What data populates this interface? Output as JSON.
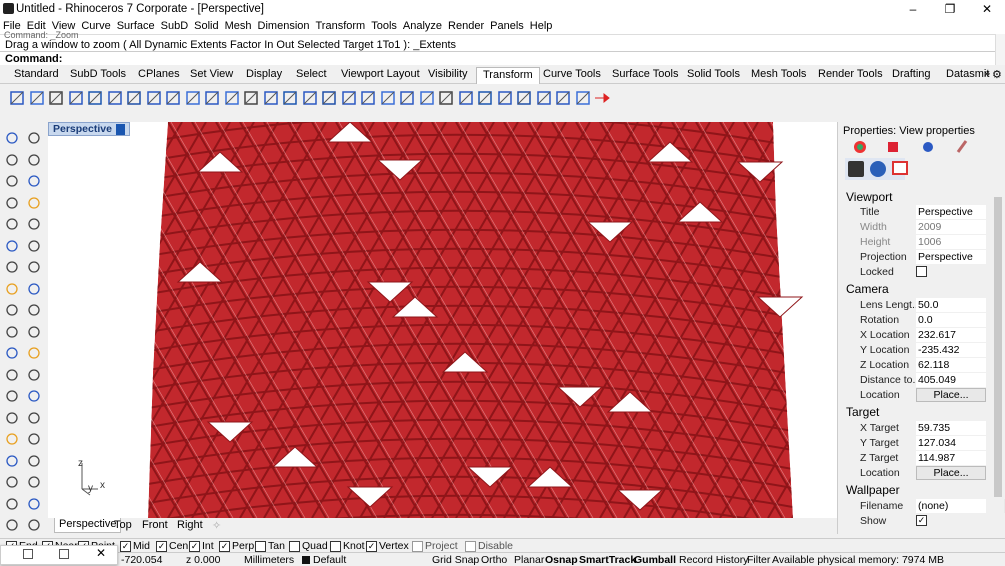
{
  "titlebar": {
    "title": "Untitled - Rhinoceros 7 Corporate - [Perspective]",
    "minimize": "–",
    "maximize": "❐",
    "close": "✕"
  },
  "menu": [
    "File",
    "Edit",
    "View",
    "Curve",
    "Surface",
    "SubD",
    "Solid",
    "Mesh",
    "Dimension",
    "Transform",
    "Tools",
    "Analyze",
    "Render",
    "Panels",
    "Help"
  ],
  "command": {
    "history_prev": "Command: _Zoom",
    "history_current": "Drag a window to zoom ( All  Dynamic  Extents  Factor  In  Out  Selected  Target  1To1 ): _Extents",
    "prompt": "Command:"
  },
  "toolbar_tabs": [
    "Standard",
    "SubD Tools",
    "CPlanes",
    "Set View",
    "Display",
    "Select",
    "Viewport Layout",
    "Visibility",
    "Transform",
    "Curve Tools",
    "Surface Tools",
    "Solid Tools",
    "Mesh Tools",
    "Render Tools",
    "Drafting",
    "Datasmit"
  ],
  "toolbar_tabs_active": "Transform",
  "toolbar_more": "»",
  "toolbar_settings": "⚙",
  "viewport": {
    "label": "Perspective",
    "axis_z": "z",
    "axis_y": "y",
    "axis_x": "x"
  },
  "viewport_tabs": [
    "Perspective",
    "Top",
    "Front",
    "Right"
  ],
  "viewport_tabs_add": "✧",
  "properties": {
    "title": "Properties: View properties",
    "viewport_section": "Viewport",
    "title_label": "Title",
    "title_value": "Perspective",
    "width_label": "Width",
    "width_value": "2009",
    "height_label": "Height",
    "height_value": "1006",
    "projection_label": "Projection",
    "projection_value": "Perspective",
    "locked_label": "Locked",
    "camera_section": "Camera",
    "lens_label": "Lens Lengt...",
    "lens_value": "50.0",
    "rotation_label": "Rotation",
    "rotation_value": "0.0",
    "xloc_label": "X Location",
    "xloc_value": "232.617",
    "yloc_label": "Y Location",
    "yloc_value": "-235.432",
    "zloc_label": "Z Location",
    "zloc_value": "62.118",
    "dist_label": "Distance to...",
    "dist_value": "405.049",
    "location_label": "Location",
    "place_button": "Place...",
    "target_section": "Target",
    "xt_label": "X Target",
    "xt_value": "59.735",
    "yt_label": "Y Target",
    "yt_value": "127.034",
    "zt_label": "Z Target",
    "zt_value": "114.987",
    "tloc_label": "Location",
    "tplace_button": "Place...",
    "wallpaper_section": "Wallpaper",
    "filename_label": "Filename",
    "filename_value": "(none)",
    "filename_browse": "...",
    "show_label": "Show"
  },
  "osnap": [
    {
      "label": "End",
      "checked": true
    },
    {
      "label": "Near",
      "checked": true
    },
    {
      "label": "Point",
      "checked": true
    },
    {
      "label": "Mid",
      "checked": true
    },
    {
      "label": "Cen",
      "checked": true
    },
    {
      "label": "Int",
      "checked": true
    },
    {
      "label": "Perp",
      "checked": true
    },
    {
      "label": "Tan",
      "checked": false
    },
    {
      "label": "Quad",
      "checked": false
    },
    {
      "label": "Knot",
      "checked": false
    },
    {
      "label": "Vertex",
      "checked": true
    },
    {
      "label": "Project",
      "checked": false
    },
    {
      "label": "Disable",
      "checked": false
    }
  ],
  "status": {
    "x": "-720.054",
    "z": "z 0.000",
    "units": "Millimeters",
    "layer": "Default",
    "grid_snap": "Grid Snap",
    "ortho": "Ortho",
    "planar": "Planar",
    "osnap": "Osnap",
    "smarttrack": "SmartTrack",
    "gumball": "Gumball",
    "record": "Record History",
    "filter": "Filter",
    "memory": "Available physical memory: 7974 MB"
  },
  "colors": {
    "mesh_red": "#c2282d",
    "mesh_dark": "#8f1519",
    "accent": "#1a56b0"
  }
}
